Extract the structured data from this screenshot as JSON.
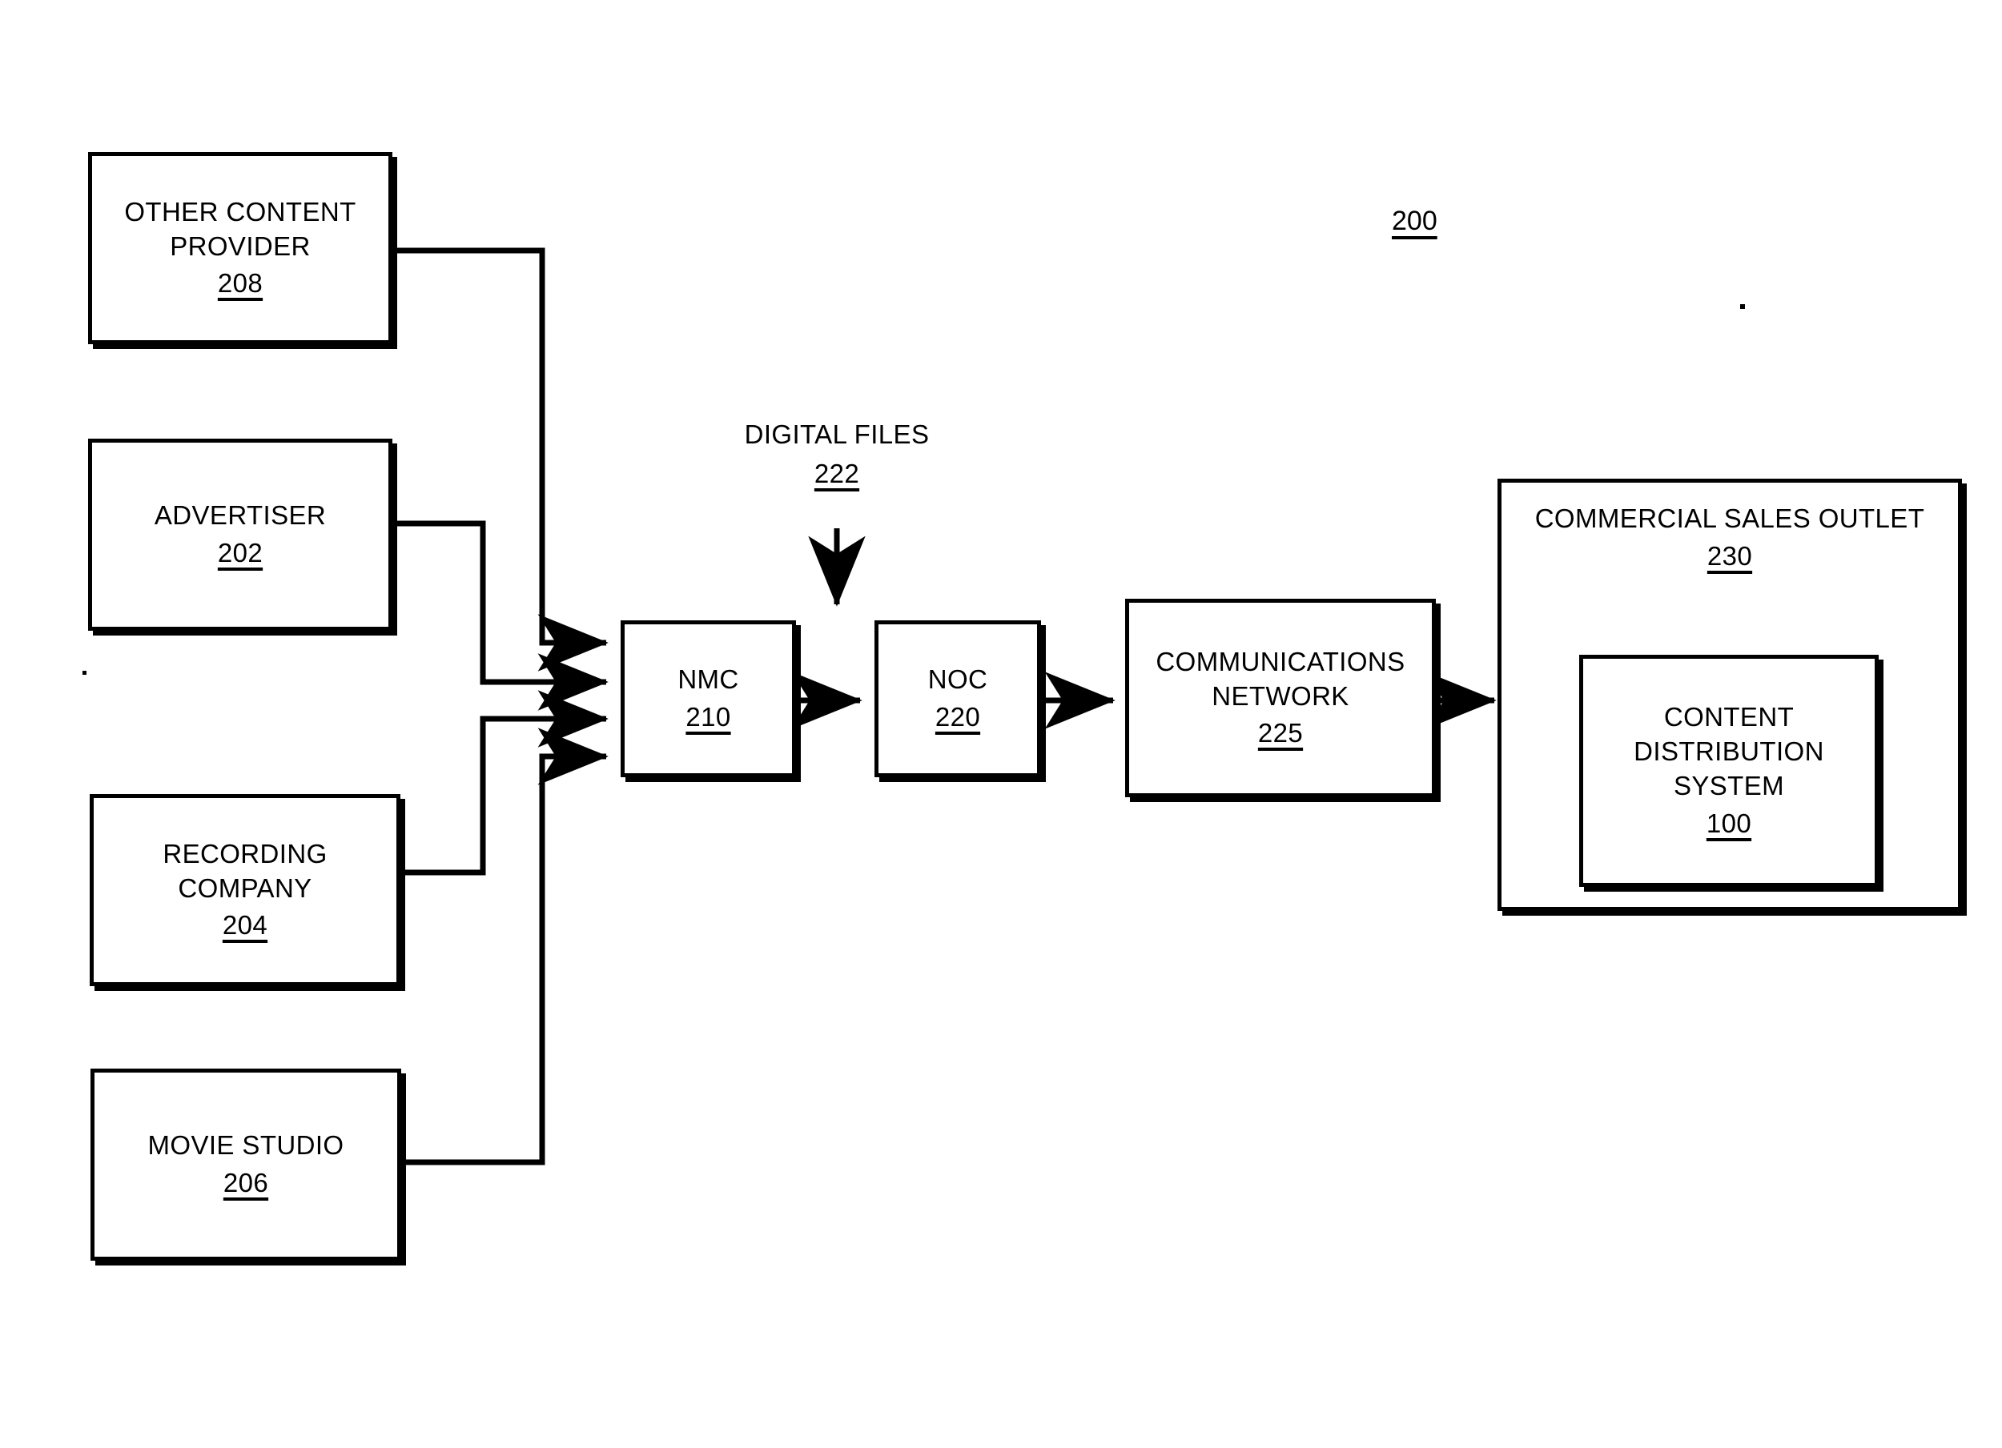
{
  "figure": {
    "figure_number": "200",
    "background_color": "#ffffff",
    "line_color": "#000000"
  },
  "nodes": {
    "other_content_provider": {
      "title": "OTHER CONTENT\nPROVIDER",
      "ref": "208"
    },
    "advertiser": {
      "title": "ADVERTISER",
      "ref": "202"
    },
    "recording_company": {
      "title": "RECORDING\nCOMPANY",
      "ref": "204"
    },
    "movie_studio": {
      "title": "MOVIE STUDIO",
      "ref": "206"
    },
    "nmc": {
      "title": "NMC",
      "ref": "210"
    },
    "noc": {
      "title": "NOC",
      "ref": "220"
    },
    "communications_network": {
      "title": "COMMUNICATIONS\nNETWORK",
      "ref": "225"
    },
    "commercial_sales_outlet": {
      "title": "COMMERCIAL SALES OUTLET",
      "ref": "230"
    },
    "content_distribution_system": {
      "title": "CONTENT\nDISTRIBUTION\nSYSTEM",
      "ref": "100"
    }
  },
  "labels": {
    "digital_files": {
      "title": "DIGITAL FILES",
      "ref": "222"
    }
  }
}
